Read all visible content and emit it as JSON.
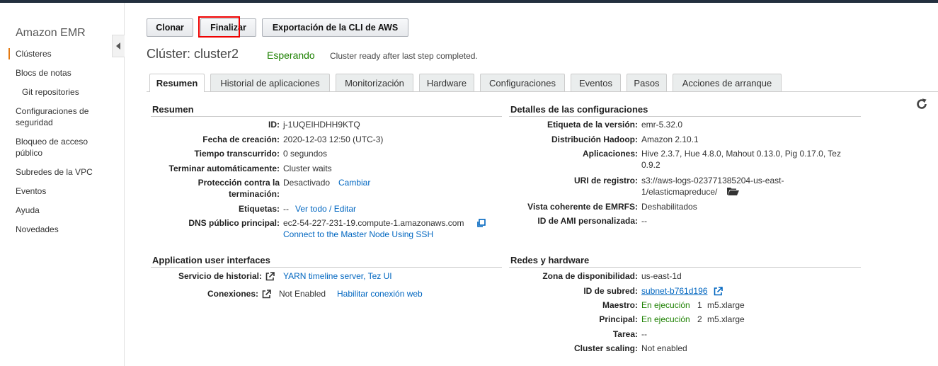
{
  "sidebar": {
    "title": "Amazon EMR",
    "items": [
      {
        "label": "Clústeres"
      },
      {
        "label": "Blocs de notas"
      },
      {
        "label": "Git repositories"
      },
      {
        "label": "Configuraciones de seguridad"
      },
      {
        "label": "Bloqueo de acceso público"
      },
      {
        "label": "Subredes de la VPC"
      },
      {
        "label": "Eventos"
      },
      {
        "label": "Ayuda"
      },
      {
        "label": "Novedades"
      }
    ]
  },
  "toolbar": {
    "clone": "Clonar",
    "terminate": "Finalizar",
    "cli_export": "Exportación de la CLI de AWS"
  },
  "cluster": {
    "title": "Clúster: cluster2",
    "status": "Esperando",
    "status_desc": "Cluster ready after last step completed."
  },
  "tabs": [
    "Resumen",
    "Historial de aplicaciones",
    "Monitorización",
    "Hardware",
    "Configuraciones",
    "Eventos",
    "Pasos",
    "Acciones de arranque"
  ],
  "summary": {
    "heading": "Resumen",
    "id_label": "ID:",
    "id_value": "j-1UQEIHDHH9KTQ",
    "created_label": "Fecha de creación:",
    "created_value": "2020-12-03 12:50 (UTC-3)",
    "elapsed_label": "Tiempo transcurrido:",
    "elapsed_value": "0 segundos",
    "autoterm_label": "Terminar automáticamente:",
    "autoterm_value": "Cluster waits",
    "protection_label_1": "Protección contra la",
    "protection_label_2": "terminación:",
    "protection_value": "Desactivado",
    "protection_link": "Cambiar",
    "tags_label": "Etiquetas:",
    "tags_value": "--",
    "tags_link": "Ver todo / Editar",
    "dns_label": "DNS público principal:",
    "dns_value": "ec2-54-227-231-19.compute-1.amazonaws.com",
    "ssh_link": "Connect to the Master Node Using SSH"
  },
  "config": {
    "heading": "Detalles de las configuraciones",
    "release_label": "Etiqueta de la versión:",
    "release_value": "emr-5.32.0",
    "hadoop_label": "Distribución Hadoop:",
    "hadoop_value": "Amazon 2.10.1",
    "apps_label": "Aplicaciones:",
    "apps_value_1": "Hive 2.3.7, Hue 4.8.0, Mahout 0.13.0, Pig 0.17.0, Tez",
    "apps_value_2": "0.9.2",
    "log_label": "URI de registro:",
    "log_value_1": "s3://aws-logs-023771385204-us-east-",
    "log_value_2": "1/elasticmapreduce/",
    "emrfs_label": "Vista coherente de EMRFS:",
    "emrfs_value": "Deshabilitados",
    "ami_label": "ID de AMI personalizada:",
    "ami_value": "--"
  },
  "app_ui": {
    "heading": "Application user interfaces",
    "history_label": "Servicio de historial:",
    "history_value": "YARN timeline server, Tez UI",
    "conn_label": "Conexiones:",
    "conn_value": "Not Enabled",
    "conn_link": "Habilitar conexión web"
  },
  "network": {
    "heading": "Redes y hardware",
    "az_label": "Zona de disponibilidad:",
    "az_value": "us-east-1d",
    "subnet_label": "ID de subred:",
    "subnet_value": "subnet-b761d196",
    "master_label": "Maestro:",
    "master_status": "En ejecución",
    "master_count": "1",
    "master_type": "m5.xlarge",
    "core_label": "Principal:",
    "core_status": "En ejecución",
    "core_count": "2",
    "core_type": "m5.xlarge",
    "task_label": "Tarea:",
    "task_value": "--",
    "scaling_label": "Cluster scaling:",
    "scaling_value": "Not enabled"
  }
}
